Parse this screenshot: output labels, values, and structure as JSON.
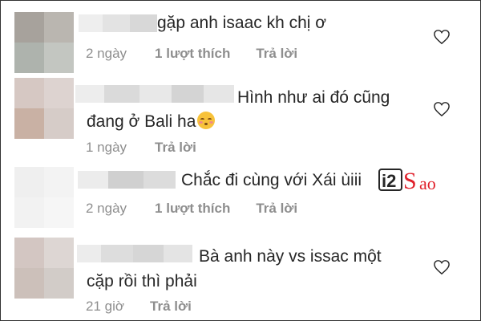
{
  "comments": [
    {
      "text_lines": [
        "gặp anh isaac kh chị ơ"
      ],
      "time": "2 ngày",
      "likes": "1 lượt thích",
      "reply": "Trả lời"
    },
    {
      "text_lines": [
        "Hình như ai đó cũng",
        "đang ở Bali ha"
      ],
      "emoji": "kissing-blushing-face",
      "time": "1 ngày",
      "reply": "Trả lời"
    },
    {
      "text_lines": [
        "Chắc đi cùng với Xái ùiii"
      ],
      "time": "2 ngày",
      "likes": "1 lượt thích",
      "reply": "Trả lời"
    },
    {
      "text_lines": [
        "Bà anh này vs issac một",
        "cặp rồi thì phải"
      ],
      "time": "21 giờ",
      "reply": "Trả lời"
    }
  ],
  "watermark": {
    "text_num": "i2",
    "text_word": "Sao",
    "color": "#e0202a"
  },
  "icons": {
    "like": "heart-outline-icon"
  }
}
